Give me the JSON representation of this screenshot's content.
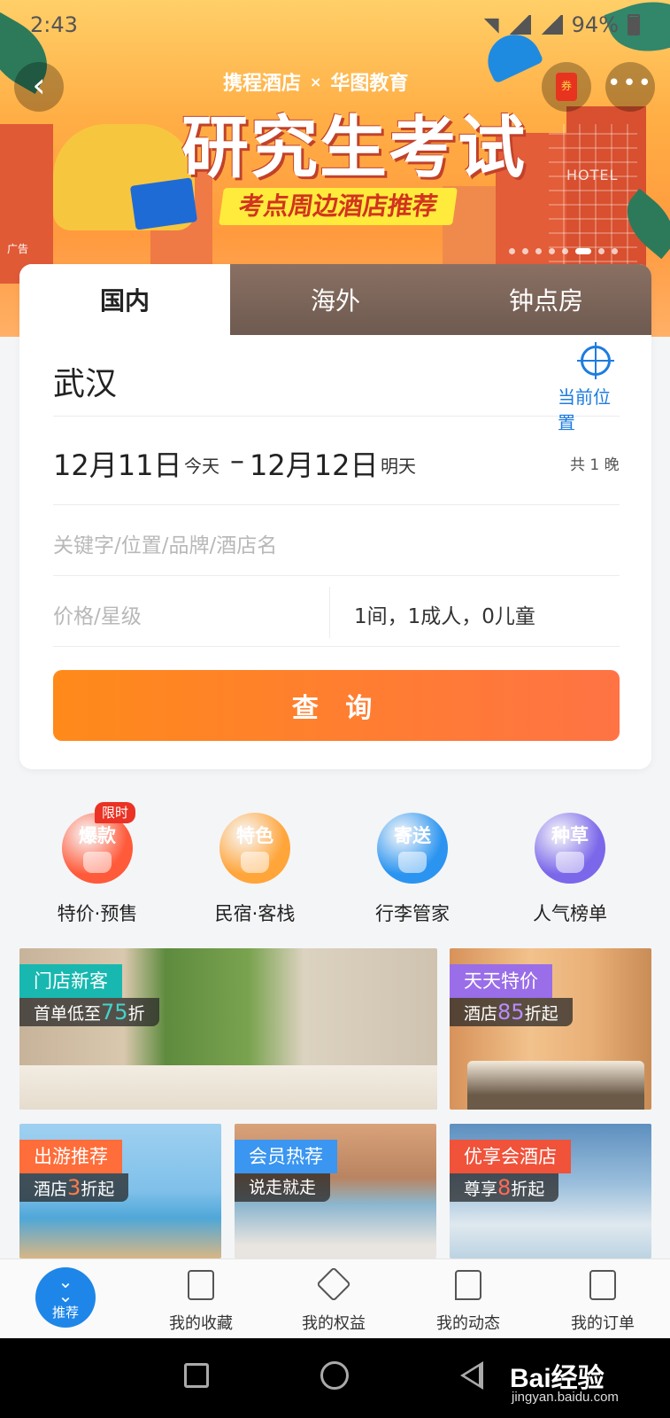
{
  "status_bar": {
    "time": "2:43",
    "battery": "94%"
  },
  "banner": {
    "ad_tag": "广告",
    "partner_1": "携程酒店",
    "partner_x": "×",
    "partner_2": "华图教育",
    "title": "研究生考试",
    "subtitle": "考点周边酒店推荐",
    "hotel_sign": "HOTEL",
    "slide_count": 8,
    "active_slide": 5
  },
  "header": {
    "back_icon": "chevron-left-icon",
    "coupon_label": "券",
    "more_label": "•••"
  },
  "search": {
    "tabs": [
      {
        "label": "国内",
        "active": true
      },
      {
        "label": "海外",
        "active": false
      },
      {
        "label": "钟点房",
        "active": false
      }
    ],
    "city": "武汉",
    "location_label": "当前位置",
    "checkin_date": "12月11日",
    "checkin_label": "今天",
    "date_separator": "–",
    "checkout_date": "12月12日",
    "checkout_label": "明天",
    "nights": "共 1 晚",
    "keyword_placeholder": "关键字/位置/品牌/酒店名",
    "price_placeholder": "价格/星级",
    "occupancy": "1间，1成人，0儿童",
    "search_button": "查 询"
  },
  "quick_entries": [
    {
      "icon_text": "爆款",
      "label": "特价·预售",
      "badge": "限时",
      "color": "#ff5a3a"
    },
    {
      "icon_text": "特色",
      "label": "民宿·客栈",
      "badge": "",
      "color": "#ffa53a"
    },
    {
      "icon_text": "寄送",
      "label": "行李管家",
      "badge": "",
      "color": "#2b94f0"
    },
    {
      "icon_text": "种草",
      "label": "人气榜单",
      "badge": "",
      "color": "#7a67ea"
    }
  ],
  "promos": [
    {
      "title": "门店新客",
      "sub_pre": "首单低至",
      "sub_hl": "75",
      "sub_post": "折",
      "title_color": "#18b8b0",
      "hl_color": "#3fd6cc"
    },
    {
      "title": "天天特价",
      "sub_pre": "酒店",
      "sub_hl": "85",
      "sub_post": "折起",
      "title_color": "#9a6ee8",
      "hl_color": "#b98cff"
    },
    {
      "title": "出游推荐",
      "sub_pre": "酒店",
      "sub_hl": "3",
      "sub_post": "折起",
      "title_color": "#ff6d3a",
      "hl_color": "#ff7c4a"
    },
    {
      "title": "会员热荐",
      "sub_pre": "说走就走",
      "sub_hl": "",
      "sub_post": "",
      "title_color": "#3a96f0",
      "hl_color": "#3a96f0"
    },
    {
      "title": "优享会酒店",
      "sub_pre": "尊享",
      "sub_hl": "8",
      "sub_post": "折起",
      "title_color": "#f0523a",
      "hl_color": "#ff6a55"
    }
  ],
  "bottom_nav": [
    {
      "label": "推荐",
      "icon": "double-chevron-down-icon"
    },
    {
      "label": "我的收藏",
      "icon": "building-icon"
    },
    {
      "label": "我的权益",
      "icon": "diamond-icon"
    },
    {
      "label": "我的动态",
      "icon": "edit-chat-icon"
    },
    {
      "label": "我的订单",
      "icon": "order-list-icon"
    }
  ],
  "watermark": {
    "brand": "Bai经验",
    "url": "jingyan.baidu.com"
  }
}
